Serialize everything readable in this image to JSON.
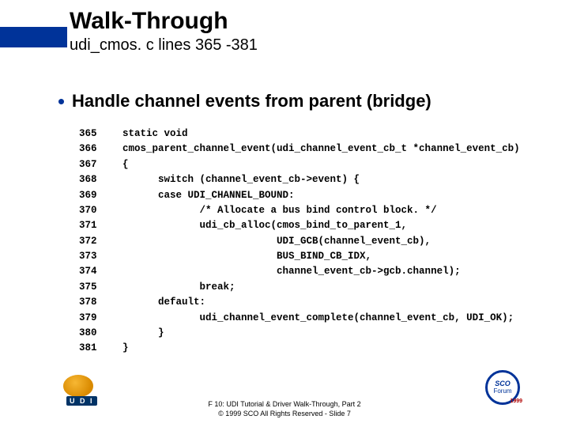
{
  "header": {
    "title": "Walk-Through",
    "subtitle": "udi_cmos. c lines 365 -381"
  },
  "bullet": {
    "text": "Handle channel events from parent (bridge)"
  },
  "code": [
    {
      "n": "365",
      "t": "static void"
    },
    {
      "n": "366",
      "t": "cmos_parent_channel_event(udi_channel_event_cb_t *channel_event_cb)"
    },
    {
      "n": "367",
      "t": "{"
    },
    {
      "n": "368",
      "t": "      switch (channel_event_cb->event) {"
    },
    {
      "n": "369",
      "t": "      case UDI_CHANNEL_BOUND:"
    },
    {
      "n": "370",
      "t": "             /* Allocate a bus bind control block. */"
    },
    {
      "n": "371",
      "t": "             udi_cb_alloc(cmos_bind_to_parent_1,"
    },
    {
      "n": "372",
      "t": "                          UDI_GCB(channel_event_cb),"
    },
    {
      "n": "373",
      "t": "                          BUS_BIND_CB_IDX,"
    },
    {
      "n": "374",
      "t": "                          channel_event_cb->gcb.channel);"
    },
    {
      "n": "375",
      "t": "             break;"
    },
    {
      "n": "378",
      "t": "      default:"
    },
    {
      "n": "379",
      "t": "             udi_channel_event_complete(channel_event_cb, UDI_OK);"
    },
    {
      "n": "380",
      "t": "      }"
    },
    {
      "n": "381",
      "t": "}"
    }
  ],
  "footer": {
    "line1": "F 10: UDI Tutorial & Driver Walk-Through, Part 2",
    "line2": "© 1999 SCO All Rights Reserved - Slide 7"
  },
  "logos": {
    "left_label": "U D I",
    "right_sco": "SCO",
    "right_forum": "Forum",
    "right_year": "1999"
  }
}
